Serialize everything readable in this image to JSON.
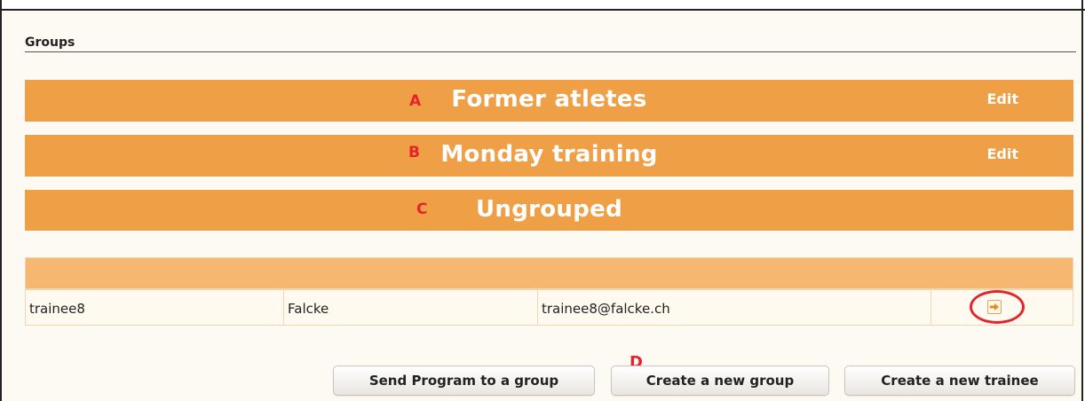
{
  "section": {
    "title": "Groups"
  },
  "groups": [
    {
      "letter": "A",
      "name": "Former atletes",
      "edit_label": "Edit"
    },
    {
      "letter": "B",
      "name": "Monday training",
      "edit_label": "Edit"
    },
    {
      "letter": "C",
      "name": "Ungrouped",
      "edit_label": ""
    }
  ],
  "table": {
    "rows": [
      {
        "username": "trainee8",
        "last_name": "Falcke",
        "email": "trainee8@falcke.ch",
        "action_icon": "move-to-group-icon"
      }
    ]
  },
  "annotation": {
    "d_letter": "D"
  },
  "buttons": {
    "send_program": "Send Program to a group",
    "create_group": "Create a new group",
    "create_trainee": "Create a new trainee"
  },
  "colors": {
    "group_bar": "#efa046",
    "table_header": "#f6b870",
    "annotation_red": "#e5232b"
  }
}
